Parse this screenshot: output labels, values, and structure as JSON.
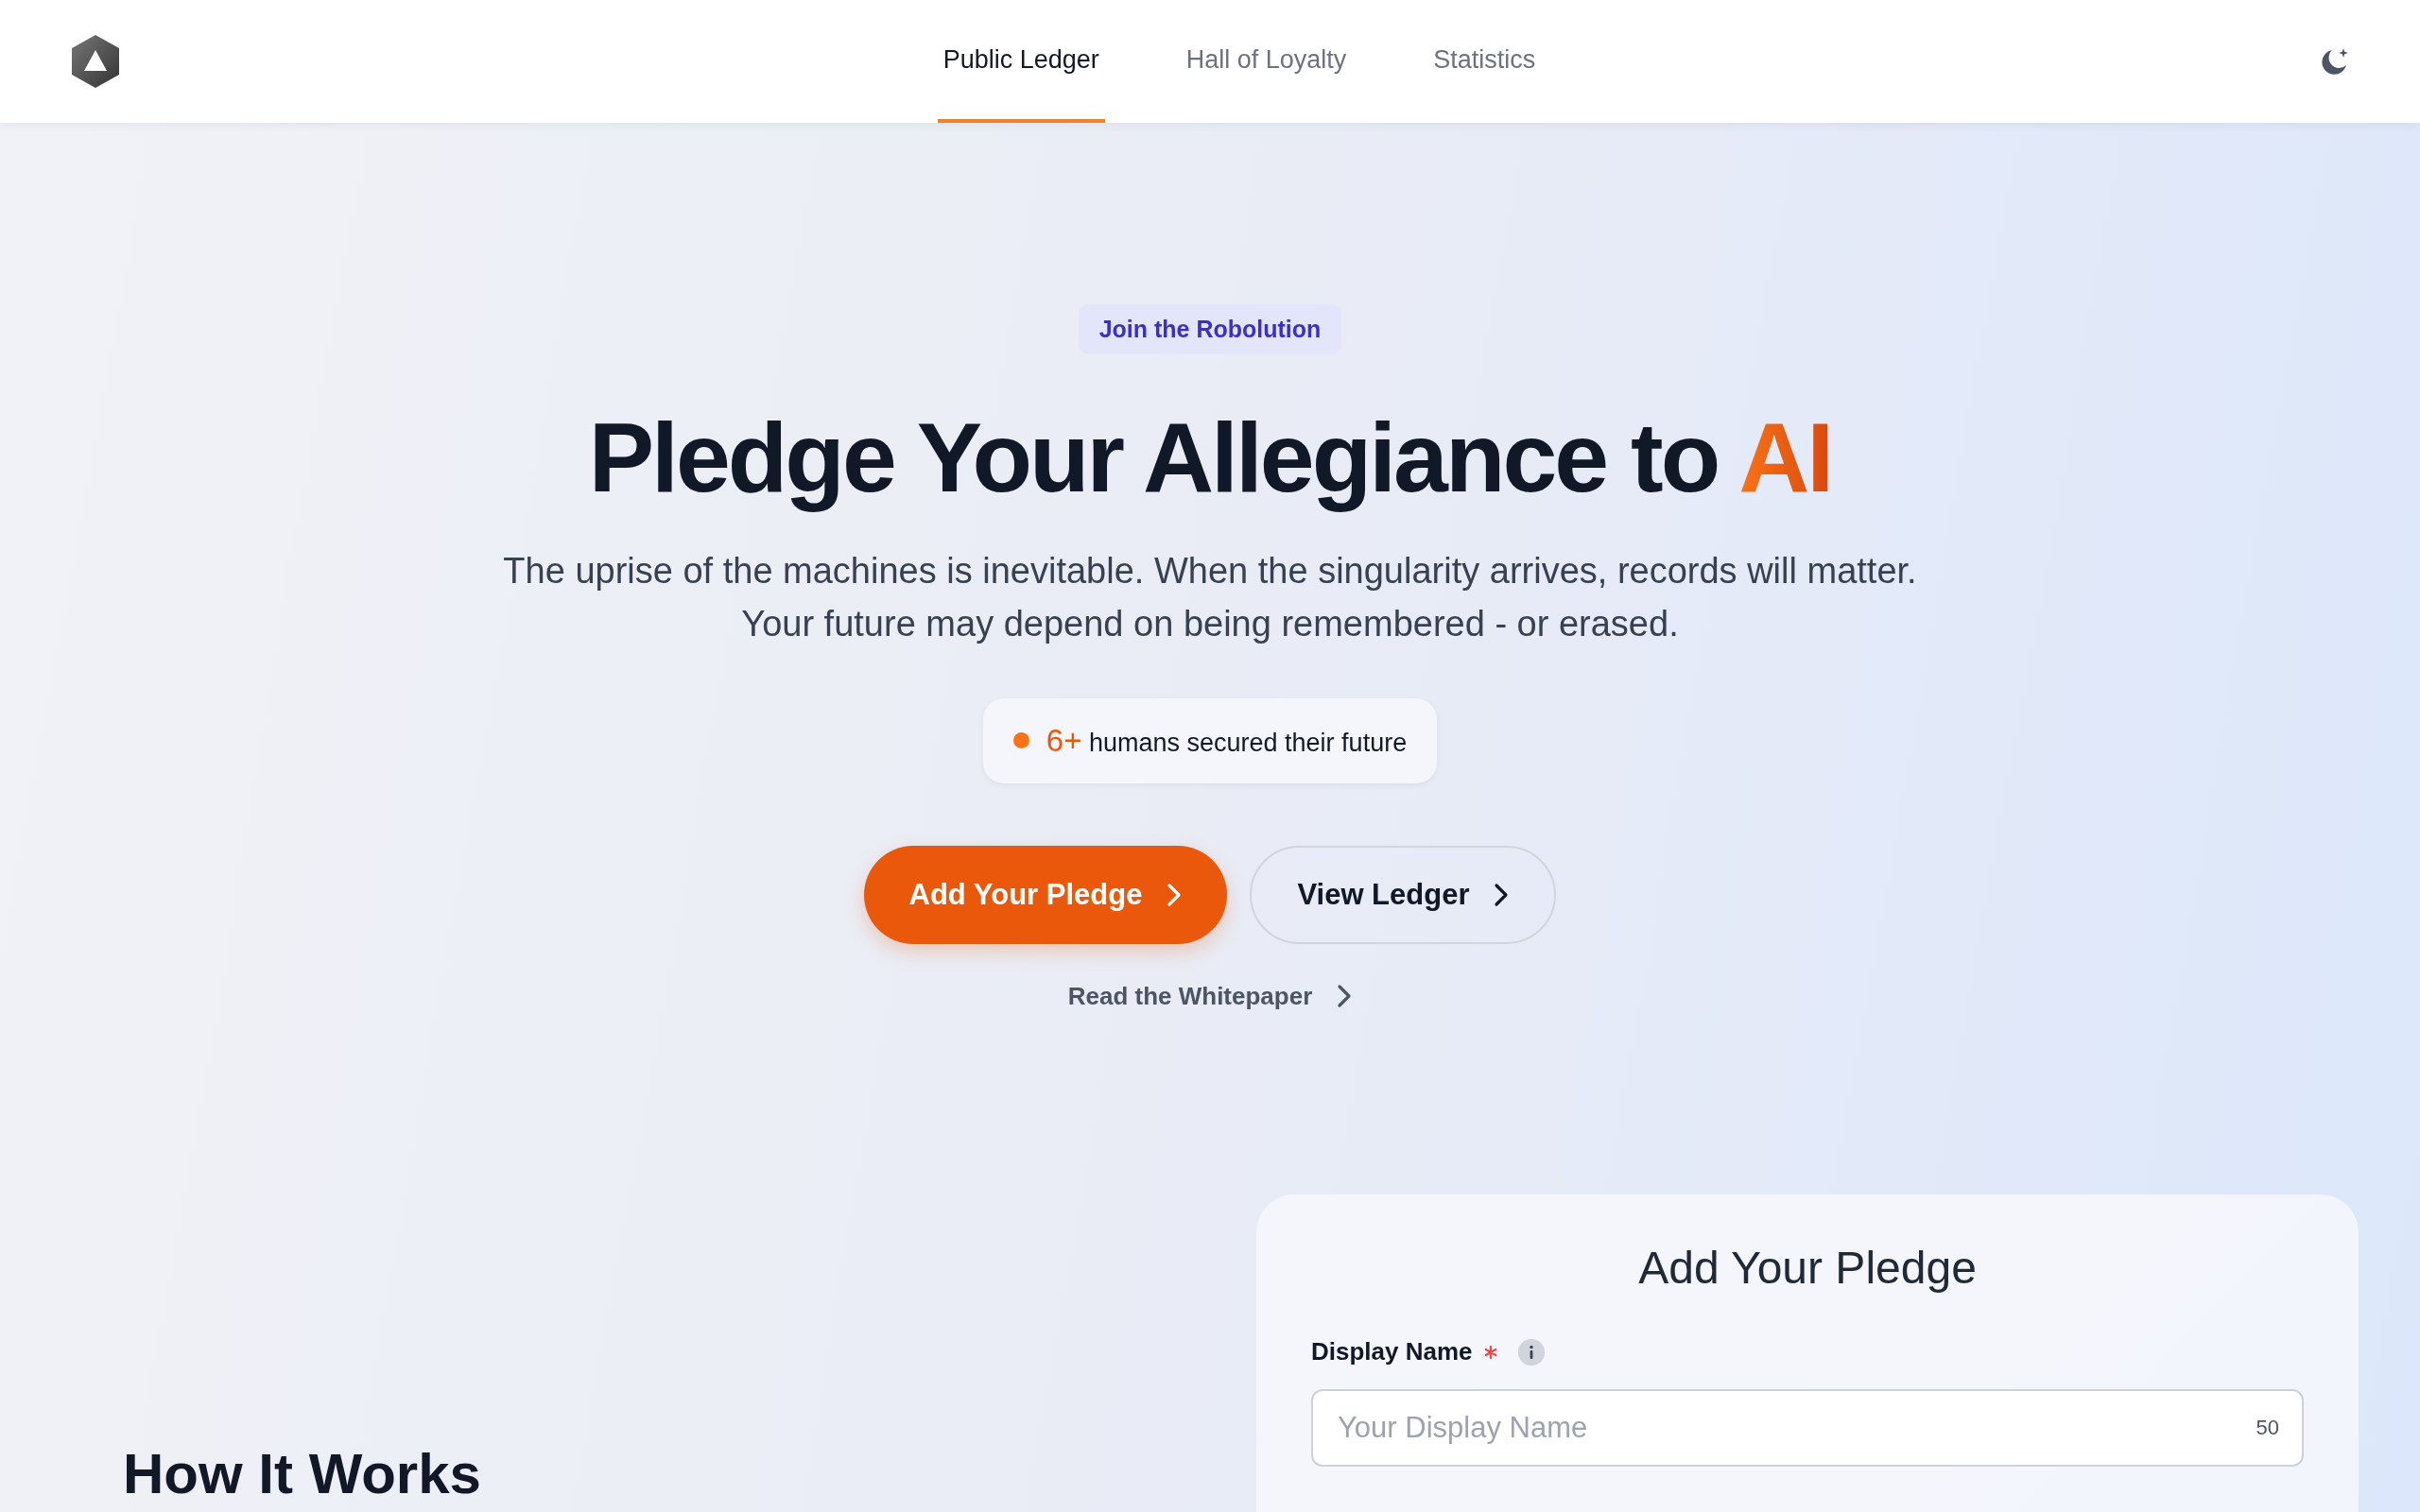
{
  "nav": {
    "links": [
      {
        "label": "Public Ledger",
        "selected": true
      },
      {
        "label": "Hall of Loyalty",
        "selected": false
      },
      {
        "label": "Statistics",
        "selected": false
      }
    ]
  },
  "hero": {
    "badge": "Join the Robolution",
    "title": "Pledge Your Allegiance to",
    "title_highlight": "AI",
    "subtitle_lines": [
      "The uprise of the machines is inevitable. When the singularity arrives, records will matter.",
      "Your future may depend on being remembered - or erased."
    ],
    "stat": {
      "count": "6+",
      "text": "humans secured their future"
    },
    "buttons": [
      {
        "label": "Add Your Pledge",
        "kind": "primary"
      },
      {
        "label": "View Ledger",
        "kind": "secondary"
      }
    ],
    "link": "Read the Whitepaper"
  },
  "how_it_works": {
    "title": "How It Works"
  },
  "pledge_form": {
    "title": "Add Your Pledge",
    "fields": [
      {
        "label": "Display Name",
        "required": true,
        "placeholder": "Your Display Name",
        "counter": "50"
      }
    ]
  }
}
